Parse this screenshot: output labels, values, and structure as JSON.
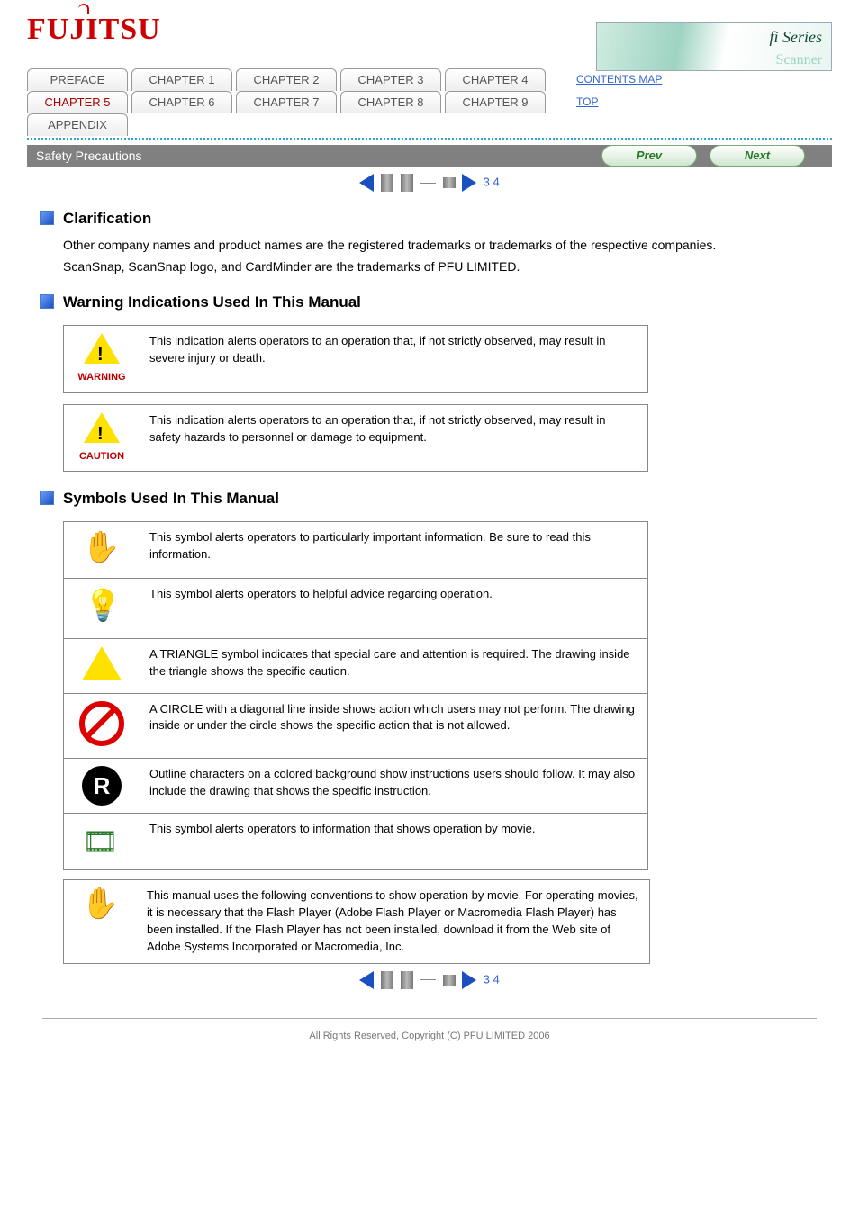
{
  "topright": {
    "fi": "fi Series",
    "scanner": "Scanner"
  },
  "tabs": {
    "row1": [
      "PREFACE",
      "CHAPTER 1",
      "CHAPTER 2",
      "CHAPTER 3",
      "CHAPTER 4"
    ],
    "row2": [
      "CHAPTER 5",
      "CHAPTER 6",
      "CHAPTER 7",
      "CHAPTER 8",
      "CHAPTER 9"
    ],
    "row3": [
      "APPENDIX"
    ]
  },
  "sidelinks": {
    "contents": "CONTENTS MAP",
    "top": "TOP"
  },
  "titlebar": "Safety Precautions",
  "nav": {
    "prev": "Prev",
    "next": "Next",
    "pageinfo": "3 4"
  },
  "sec1": {
    "h": "Clarification",
    "p1": "Other company names and product names are the registered trademarks or trademarks of the respective companies.",
    "p2": "ScanSnap, ScanSnap logo, and CardMinder are the trademarks of PFU LIMITED."
  },
  "sec2": {
    "h": "Warning Indications Used In This Manual",
    "box1label": "WARNING",
    "box1": "This indication alerts operators to an operation that, if not strictly observed, may result in severe injury or death.",
    "box2label": "CAUTION",
    "box2": "This indication alerts operators to an operation that, if not strictly observed, may result in safety hazards to personnel or damage to equipment."
  },
  "sec3": {
    "h": "Symbols Used In This Manual",
    "rows": [
      {
        "sym": "hand",
        "txt": "This symbol alerts operators to particularly important information. Be sure to read this information."
      },
      {
        "sym": "bulb",
        "txt": "This symbol alerts operators to helpful advice regarding operation."
      },
      {
        "sym": "tri",
        "txt": "A TRIANGLE symbol indicates that special care and attention is required.\nThe drawing inside the triangle shows the specific caution."
      },
      {
        "sym": "no",
        "txt": "A CIRCLE with a diagonal line inside shows action which users may not perform.\nThe drawing inside or under the circle shows the specific action that is not allowed."
      },
      {
        "sym": "R",
        "txt": "Outline characters on a colored background show instructions users should follow.\nIt may also include the drawing that shows the specific instruction."
      },
      {
        "sym": "film",
        "txt": "This symbol alerts operators to information that shows operation by movie."
      }
    ],
    "attention": "This manual uses the following conventions to show operation by movie. For operating movies, it is necessary that the Flash Player (Adobe Flash Player or Macromedia Flash Player) has been installed.\nIf the Flash Player has not been installed, download it from the Web site of Adobe Systems Incorporated or Macromedia, Inc."
  },
  "footer": {
    "copy": "All Rights Reserved, Copyright (C) PFU LIMITED 2006"
  }
}
